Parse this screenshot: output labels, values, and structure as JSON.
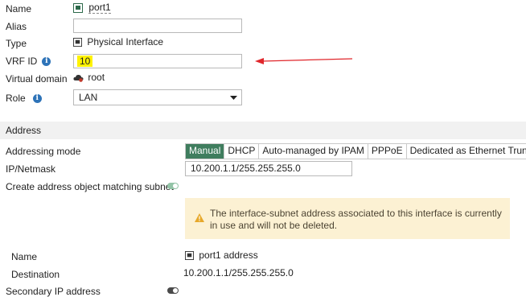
{
  "fields": {
    "name_label": "Name",
    "name_value": "port1",
    "alias_label": "Alias",
    "alias_value": "",
    "type_label": "Type",
    "type_value": "Physical Interface",
    "vrf_label": "VRF ID",
    "vrf_value": "10",
    "vdom_label": "Virtual domain",
    "vdom_value": "root",
    "role_label": "Role",
    "role_value": "LAN"
  },
  "address": {
    "section_title": "Address",
    "mode_label": "Addressing mode",
    "modes": [
      "Manual",
      "DHCP",
      "Auto-managed by IPAM",
      "PPPoE",
      "Dedicated as Ethernet Trunk"
    ],
    "selected_mode": "Manual",
    "ipmask_label": "IP/Netmask",
    "ipmask_value": "10.200.1.1/255.255.255.0",
    "create_obj_label": "Create address object matching subnet",
    "create_obj_enabled": true,
    "warning": "The interface-subnet address associated to this interface is currently in use and will not be deleted.",
    "obj_name_label": "Name",
    "obj_name_value": "port1 address",
    "dest_label": "Destination",
    "dest_value": "10.200.1.1/255.255.255.0",
    "secondary_label": "Secondary IP address",
    "secondary_enabled": false
  },
  "colors": {
    "manual_active": "#3f7d5e",
    "highlight": "#fff200",
    "annotation_arrow": "#e0262b",
    "warning_bg": "#fcf1d3",
    "info_icon": "#2e73b8"
  }
}
